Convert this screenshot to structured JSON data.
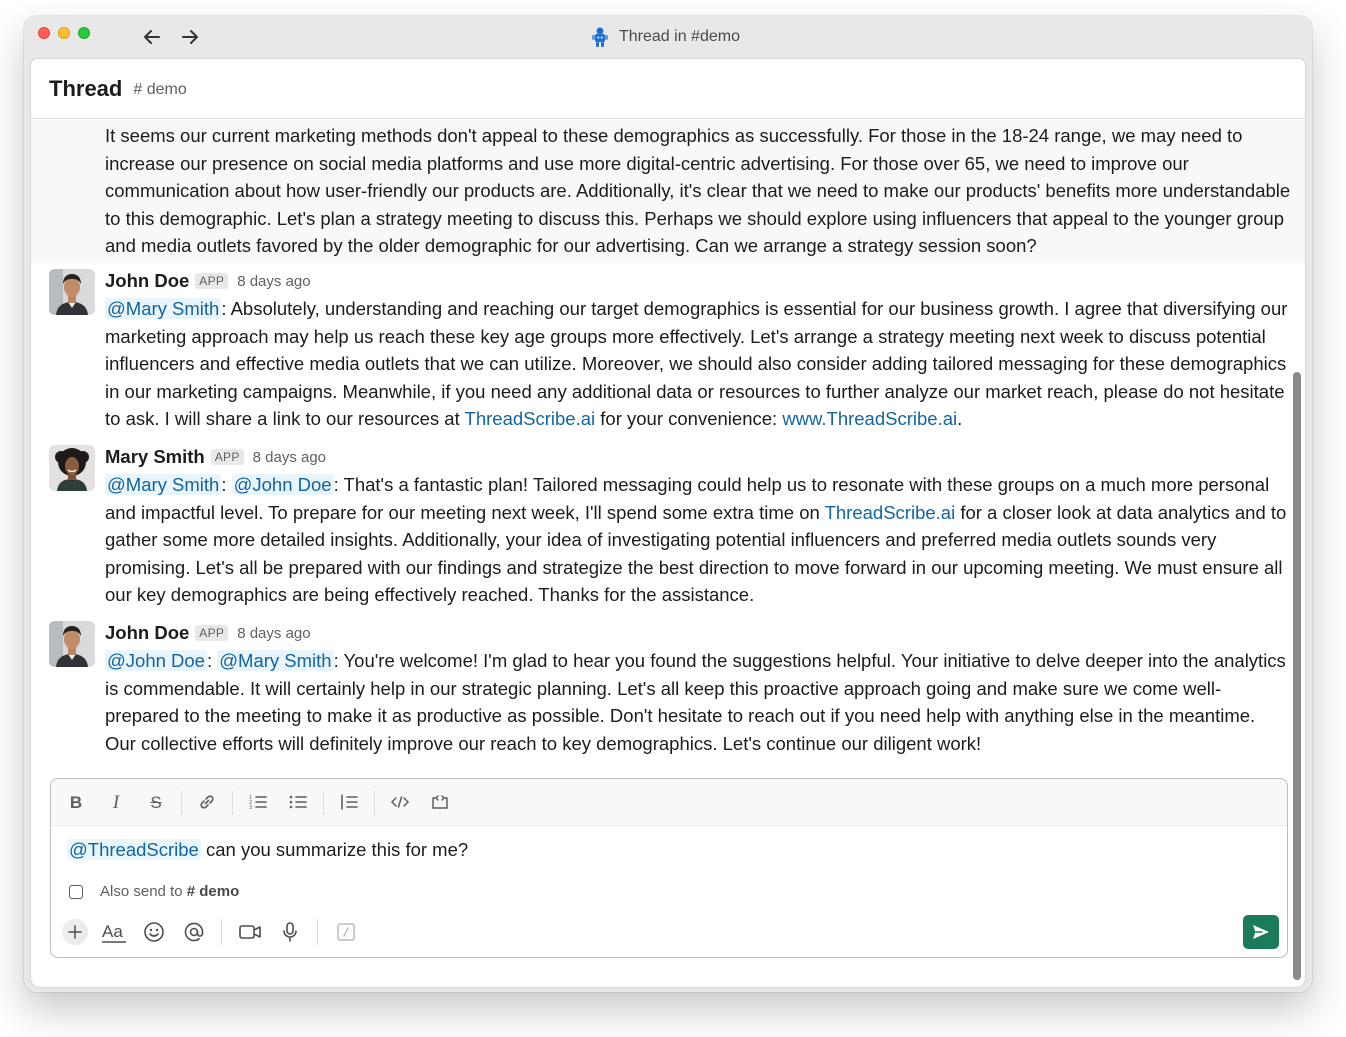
{
  "window": {
    "title": "Thread in #demo"
  },
  "header": {
    "title": "Thread",
    "channel": "# demo"
  },
  "first_message": {
    "text": "It seems our current marketing methods don't appeal to these demographics as successfully. For those in the 18-24 range, we may need to increase our presence on social media platforms and use more digital-centric advertising. For those over 65, we need to improve our communication about how user-friendly our products are. Additionally, it's clear that we need to make our products' benefits more understandable to this demographic. Let's plan a strategy meeting to discuss this. Perhaps we should explore using influencers that appeal to the younger group and media outlets favored by the older demographic for our advertising. Can we arrange a strategy session soon?"
  },
  "messages": [
    {
      "author": "John Doe",
      "badge": "APP",
      "time": "8 days ago",
      "mention1": "@Mary Smith",
      "sep1": ":",
      "text_a": " Absolutely, understanding and reaching our target demographics is essential for our business growth. I agree that diversifying our marketing approach may help us reach these key age groups more effectively. Let's arrange a strategy meeting next week to discuss potential influencers and effective media outlets that we can utilize. Moreover, we should also consider adding tailored messaging for these demographics in our marketing campaigns. Meanwhile, if you need any additional data or resources to further analyze our market reach, please do not hesitate to ask. I will share a link to our resources at ",
      "link1": "ThreadScribe.ai",
      "text_b": " for your convenience: ",
      "link2": "www.ThreadScribe.ai",
      "text_c": "."
    },
    {
      "author": "Mary Smith",
      "badge": "APP",
      "time": "8 days ago",
      "mention1": "@Mary Smith",
      "sep1": ": ",
      "mention2": "@John Doe",
      "sep2": ":",
      "text_a": " That's a fantastic plan! Tailored messaging could help us to resonate with these groups on a much more personal and impactful level. To prepare for our meeting next week, I'll spend some extra time on ",
      "link1": "ThreadScribe.ai",
      "text_b": " for a closer look at data analytics and to gather some more detailed insights. Additionally, your idea of investigating potential influencers and preferred media outlets sounds very promising. Let's all be prepared with our findings and strategize the best direction to move forward in our upcoming meeting. We must ensure all our key demographics are being effectively reached. Thanks for the assistance."
    },
    {
      "author": "John Doe",
      "badge": "APP",
      "time": "8 days ago",
      "mention1": "@John Doe",
      "sep1": ": ",
      "mention2": "@Mary Smith",
      "sep2": ":",
      "text_a": " You're welcome! I'm glad to hear you found the suggestions helpful. Your initiative to delve deeper into the analytics is commendable. It will certainly help in our strategic planning. Let's all keep this proactive approach going and make sure we come well-prepared to the meeting to make it as productive as possible. Don't hesitate to reach out if you need help with anything else in the meantime. Our collective efforts will definitely improve our reach to key demographics. Let's continue our diligent work!"
    }
  ],
  "composer": {
    "mention": "@ThreadScribe",
    "text": " can you summarize this for me?",
    "also_send_label": "Also send to",
    "also_send_channel": "# demo"
  },
  "colors": {
    "mention_text": "#1264a3",
    "mention_bg": "#e8f5fa",
    "send_button": "#1a7c5a"
  }
}
